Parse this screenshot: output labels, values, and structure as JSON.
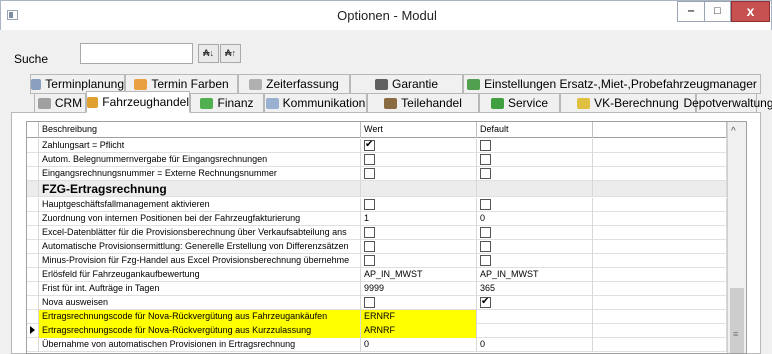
{
  "window": {
    "title": "Optionen - Modul",
    "min_label": "‒",
    "max_label": "□",
    "close_label": "x"
  },
  "search": {
    "label": "Suche",
    "value": "",
    "btn1": "₳↓",
    "btn2": "₳↑"
  },
  "tabs_row1": [
    {
      "label": "Terminplanung",
      "icon": "calendar-icon",
      "color": "#8aa0c0"
    },
    {
      "label": "Termin Farben",
      "icon": "palette-icon",
      "color": "#e8a040"
    },
    {
      "label": "Zeiterfassung",
      "icon": "clock-icon",
      "color": "#b0b0b0"
    },
    {
      "label": "Garantie",
      "icon": "certificate-icon",
      "color": "#606060"
    },
    {
      "label": "Einstellungen Ersatz-,Miet-,Probefahrzeugmanager",
      "icon": "puzzle-icon",
      "color": "#50a050"
    }
  ],
  "tabs_row2": [
    {
      "label": "CRM",
      "icon": "crm-icon",
      "color": "#a0a0a0"
    },
    {
      "label": "Fahrzeughandel",
      "icon": "puzzle-icon",
      "color": "#e0a030",
      "selected": true
    },
    {
      "label": "Finanz",
      "icon": "dollar-icon",
      "color": "#50b050"
    },
    {
      "label": "Kommunikation",
      "icon": "chat-icon",
      "color": "#9ab0d0"
    },
    {
      "label": "Teilehandel",
      "icon": "tools-icon",
      "color": "#8a6a40"
    },
    {
      "label": "Service",
      "icon": "puzzle-icon",
      "color": "#40a040"
    },
    {
      "label": "VK-Berechnung",
      "icon": "euro-icon",
      "color": "#e0c040"
    },
    {
      "label": "Depotverwaltung",
      "icon": "depot-icon",
      "color": "#607080"
    }
  ],
  "grid": {
    "headers": [
      "Beschreibung",
      "Wert",
      "Default",
      ""
    ],
    "rows": [
      {
        "label": "Zahlungsart = Pflicht",
        "wert": {
          "cb": true
        },
        "default": {
          "cb": false
        }
      },
      {
        "label": "Autom. Belegnummernvergabe für Eingangsrechnungen",
        "wert": {
          "cb": false
        },
        "default": {
          "cb": false
        }
      },
      {
        "label": "Eingangsrechnungsnummer = Externe Rechnungsnummer",
        "wert": {
          "cb": false
        },
        "default": {
          "cb": false
        }
      },
      {
        "label": "FZG-Ertragsrechnung",
        "section": true
      },
      {
        "label": "Hauptgeschäftsfallmanagement aktivieren",
        "wert": {
          "cb": false
        },
        "default": {
          "cb": false
        }
      },
      {
        "label": "Zuordnung von internen Positionen bei der Fahrzeugfakturierung",
        "wert": {
          "text": "1"
        },
        "default": {
          "text": "0"
        }
      },
      {
        "label": "Excel-Datenblätter für die Provisionsberechnung über Verkaufsabteilung ans",
        "wert": {
          "cb": false
        },
        "default": {
          "cb": false
        }
      },
      {
        "label": "Automatische Provisionsermittlung: Generelle Erstellung von Differenzsätzen",
        "wert": {
          "cb": false
        },
        "default": {
          "cb": false
        }
      },
      {
        "label": "Minus-Provision für Fzg-Handel aus Excel Provisionsberechnung übernehme",
        "wert": {
          "cb": false
        },
        "default": {
          "cb": false
        }
      },
      {
        "label": "Erlösfeld für Fahrzeugankaufbewertung",
        "wert": {
          "text": "AP_IN_MWST"
        },
        "default": {
          "text": "AP_IN_MWST"
        }
      },
      {
        "label": "Frist für int. Aufträge in Tagen",
        "wert": {
          "text": "9999"
        },
        "default": {
          "text": "365"
        }
      },
      {
        "label": "Nova ausweisen",
        "wert": {
          "cb": false
        },
        "default": {
          "cb": true
        }
      },
      {
        "label": "Ertragsrechnungscode für Nova-Rückvergütung aus Fahrzeugankäufen",
        "wert": {
          "text": "ERNRF"
        },
        "default": {
          "text": ""
        },
        "highlight": true
      },
      {
        "label": "Ertragsrechnungscode für Nova-Rückvergütung aus Kurzzulassung",
        "wert": {
          "text": "ARNRF"
        },
        "default": {
          "text": ""
        },
        "highlight": true,
        "current": true
      },
      {
        "label": "Übernahme von automatischen Provisionen in Ertragsrechnung",
        "wert": {
          "text": "0"
        },
        "default": {
          "text": "0"
        }
      }
    ],
    "scroll_up": "^",
    "scroll_grip": "≡"
  }
}
